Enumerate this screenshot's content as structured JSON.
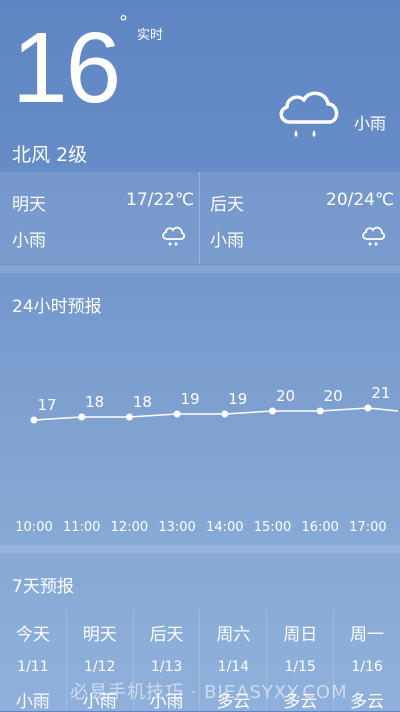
{
  "current": {
    "temperature": "16",
    "degree_symbol": "°",
    "realtime_label": "实时",
    "wind": "北风 2级",
    "weather": "小雨",
    "icon": "rain-cloud-icon"
  },
  "forecast_short": [
    {
      "day": "明天",
      "temp_range": "17/22℃",
      "weather": "小雨",
      "icon": "rain-cloud-icon"
    },
    {
      "day": "后天",
      "temp_range": "20/24℃",
      "weather": "小雨",
      "icon": "rain-cloud-icon"
    }
  ],
  "hourly": {
    "title": "24小时预报",
    "times": [
      "10:00",
      "11:00",
      "12:00",
      "13:00",
      "14:00",
      "15:00",
      "16:00",
      "17:00"
    ],
    "temps": [
      17,
      18,
      18,
      19,
      19,
      20,
      20,
      21
    ]
  },
  "chart_data": {
    "type": "line",
    "title": "24小时预报",
    "x": [
      "10:00",
      "11:00",
      "12:00",
      "13:00",
      "14:00",
      "15:00",
      "16:00",
      "17:00"
    ],
    "series": [
      {
        "values": [
          17,
          18,
          18,
          19,
          19,
          20,
          20,
          21
        ]
      }
    ],
    "xlabel": "",
    "ylabel": ""
  },
  "seven_day": {
    "title": "7天预报",
    "days": [
      {
        "name": "今天",
        "date": "1/11",
        "weather": "小雨"
      },
      {
        "name": "明天",
        "date": "1/12",
        "weather": "小雨"
      },
      {
        "name": "后天",
        "date": "1/13",
        "weather": "小雨"
      },
      {
        "name": "周六",
        "date": "1/14",
        "weather": "多云"
      },
      {
        "name": "周日",
        "date": "1/15",
        "weather": "多云"
      },
      {
        "name": "周一",
        "date": "1/16",
        "weather": "多云"
      }
    ]
  },
  "watermark": "必易手机技巧 · BIEASYXY.COM"
}
